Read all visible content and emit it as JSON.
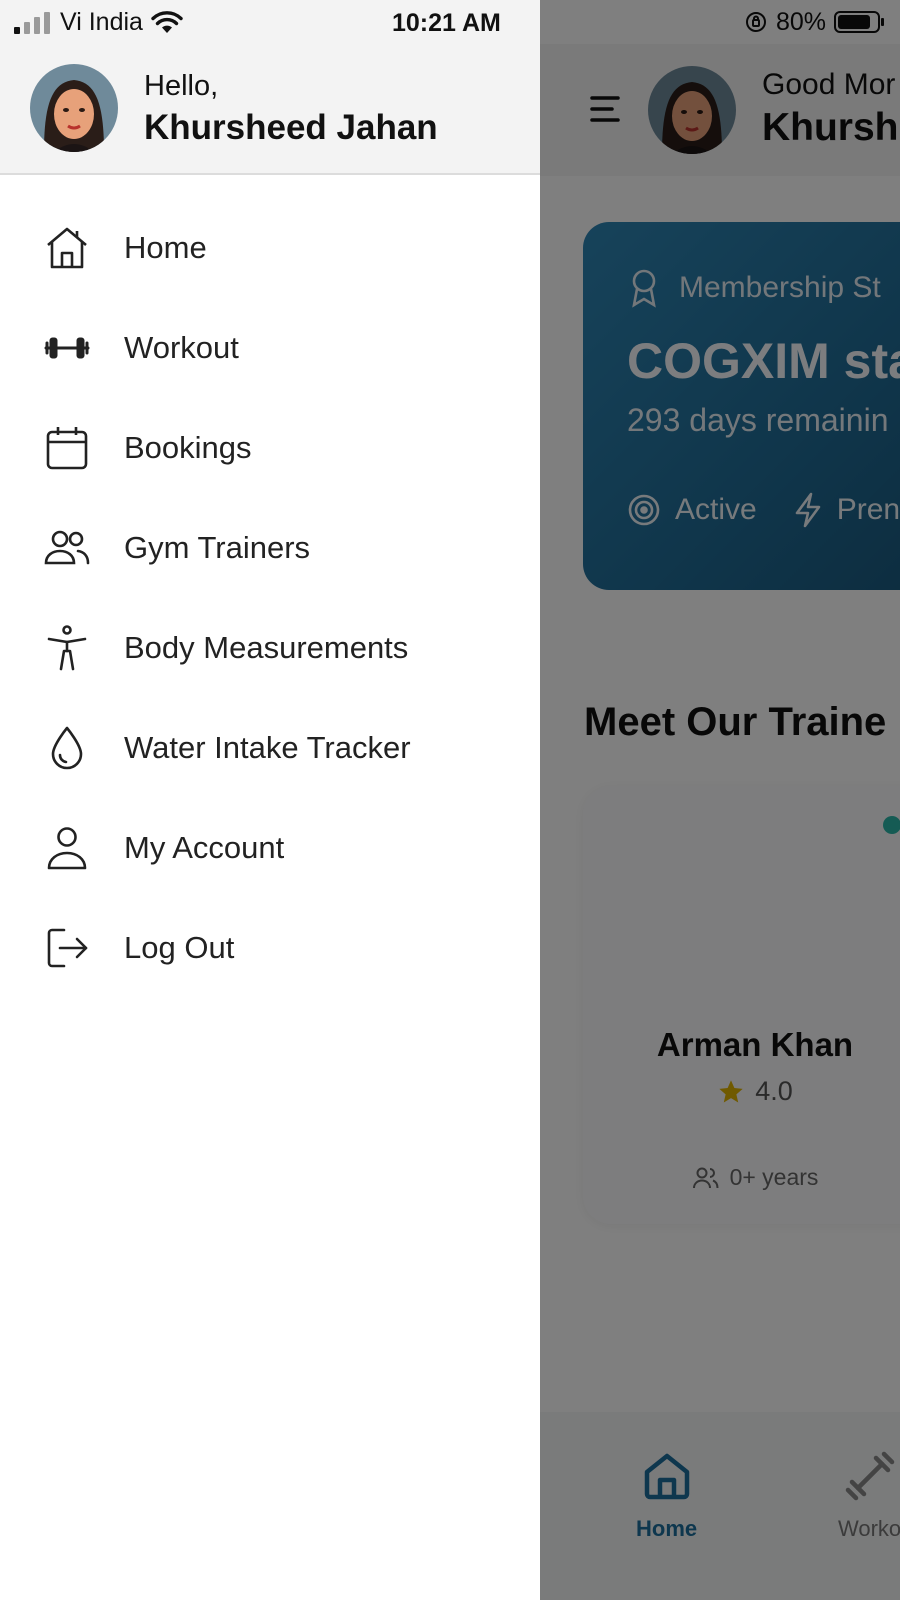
{
  "status_bar": {
    "carrier": "Vi India",
    "time": "10:21 AM",
    "battery": "80%"
  },
  "drawer": {
    "greeting": "Hello,",
    "user_name": "Khursheed Jahan",
    "items": [
      {
        "label": "Home",
        "icon": "home-icon"
      },
      {
        "label": "Workout",
        "icon": "dumbbell-icon"
      },
      {
        "label": "Bookings",
        "icon": "calendar-icon"
      },
      {
        "label": "Gym Trainers",
        "icon": "users-icon"
      },
      {
        "label": "Body Measurements",
        "icon": "body-icon"
      },
      {
        "label": "Water Intake Tracker",
        "icon": "droplet-icon"
      },
      {
        "label": "My Account",
        "icon": "user-icon"
      },
      {
        "label": "Log Out",
        "icon": "logout-icon"
      }
    ]
  },
  "background": {
    "header": {
      "greeting": "Good Mor",
      "user_name": "Khurshe"
    },
    "membership": {
      "label": "Membership St",
      "title": "COGXIM sta",
      "days_remaining": "293 days remainin",
      "status": "Active",
      "tier": "Pren"
    },
    "trainers_section_title": "Meet Our Traine",
    "trainer": {
      "name": "Arman Khan",
      "rating": "4.0",
      "experience": "0+ years"
    },
    "bottom_nav": {
      "home_label": "Home",
      "workout_label": "Worko"
    }
  },
  "colors": {
    "accent": "#1d6e9c",
    "card_gradient_start": "#2e86b5",
    "card_gradient_end": "#19567a",
    "online_dot": "#2bb6a8",
    "star": "#e0b400"
  }
}
